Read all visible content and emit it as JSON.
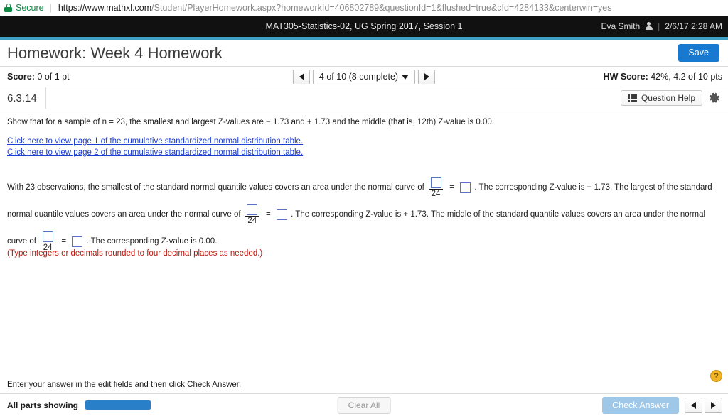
{
  "browser": {
    "secure_label": "Secure",
    "lock_icon": "lock-icon",
    "url_domain": "https://www.mathxl.com",
    "url_path": "/Student/PlayerHomework.aspx?homeworkId=406802789&questionId=1&flushed=true&cId=4284133&centerwin=yes"
  },
  "header": {
    "course_title": "MAT305-Statistics-02, UG Spring 2017, Session 1",
    "user_name": "Eva Smith",
    "user_icon": "person-icon",
    "divider": "|",
    "timestamp": "2/6/17 2:28 AM",
    "accent_color": "#3d9fc4",
    "background_color": "#111111"
  },
  "title_bar": {
    "title": "Homework: Week 4 Homework",
    "save_label": "Save",
    "save_color": "#1779d0"
  },
  "score_bar": {
    "score_label": "Score:",
    "score_value": "0 of 1 pt",
    "prev_icon": "triangle-left-icon",
    "next_icon": "triangle-right-icon",
    "question_selector": "4 of 10 (8 complete)",
    "dropdown_icon": "chevron-down-icon",
    "hw_score_label": "HW Score:",
    "hw_score_value": "42%, 4.2 of 10 pts"
  },
  "question_bar": {
    "question_id": "6.3.14",
    "help_label": "Question Help",
    "help_icon": "list-icon",
    "settings_icon": "gear-icon"
  },
  "question": {
    "statement": "Show that for a sample of n = 23, the smallest and largest Z-values are − 1.73 and + 1.73 and the middle (that is, 12th) Z-value is 0.00.",
    "links": [
      "Click here to view page 1 of the cumulative standardized normal distribution table.",
      "Click here to view page 2 of the cumulative standardized normal distribution table."
    ],
    "answer_text": {
      "seg1": "With 23 observations, the smallest of the standard normal quantile values covers an area under the normal curve of",
      "denominator1": "24",
      "equals": "=",
      "seg2": ". The corresponding Z-value is − 1.73. The largest of the standard normal quantile values covers an area under the normal curve of",
      "denominator2": "24",
      "seg3": ". The corresponding Z-value is + 1.73. The middle of the standard quantile values covers an area under the normal curve of",
      "denominator3": "24",
      "seg4": ". The corresponding Z-value is 0.00.",
      "input_value": ""
    },
    "hint": "(Type integers or decimals rounded to four decimal places as needed.)",
    "hint_color": "#c0140c"
  },
  "footer": {
    "instruction": "Enter your answer in the edit fields and then click Check Answer.",
    "help_badge": "?",
    "parts_label": "All parts showing",
    "progress_percent": 100,
    "progress_color": "#2a7fc9",
    "clear_all_label": "Clear All",
    "check_answer_label": "Check Answer",
    "prev_icon": "triangle-left-icon",
    "next_icon": "triangle-right-icon"
  }
}
